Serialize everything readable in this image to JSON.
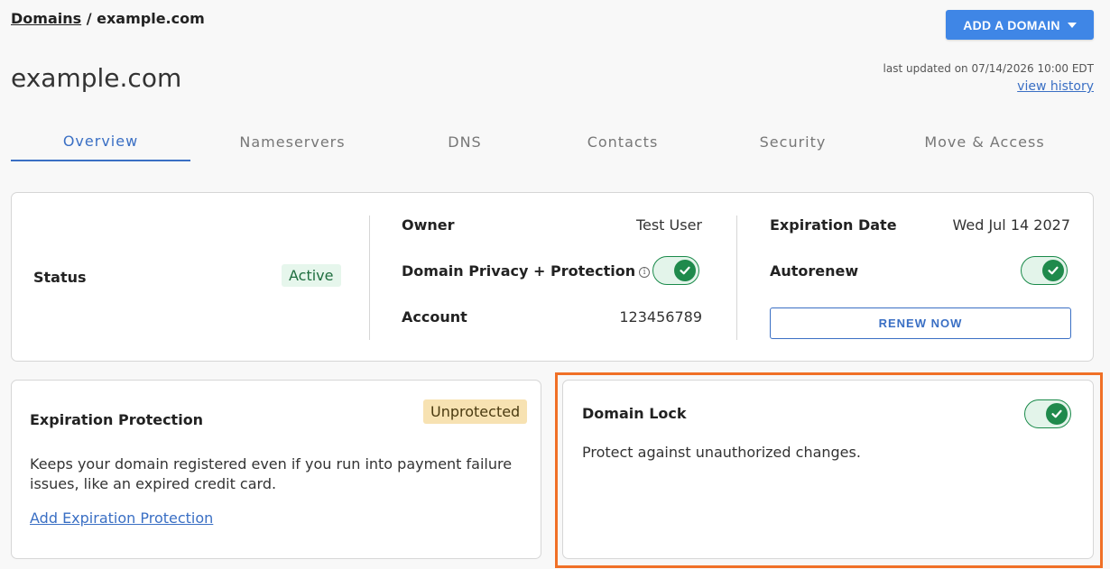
{
  "breadcrumb": {
    "parent": "Domains",
    "separator": " / ",
    "current": "example.com"
  },
  "header": {
    "add_domain_label": "ADD A DOMAIN",
    "title": "example.com",
    "last_updated": "last updated on 07/14/2026 10:00 EDT",
    "view_history": "view history"
  },
  "tabs": [
    {
      "label": "Overview",
      "active": true
    },
    {
      "label": "Nameservers",
      "active": false
    },
    {
      "label": "DNS",
      "active": false
    },
    {
      "label": "Contacts",
      "active": false
    },
    {
      "label": "Security",
      "active": false
    },
    {
      "label": "Move & Access",
      "active": false
    }
  ],
  "status_card": {
    "status_label": "Status",
    "status_value": "Active",
    "owner_label": "Owner",
    "owner_value": "Test User",
    "privacy_label": "Domain Privacy + Protection",
    "privacy_enabled": true,
    "account_label": "Account",
    "account_value": "123456789",
    "expiration_label": "Expiration Date",
    "expiration_value": "Wed Jul 14 2027",
    "autorenew_label": "Autorenew",
    "autorenew_enabled": true,
    "renew_label": "RENEW NOW"
  },
  "expiration_card": {
    "title": "Expiration Protection",
    "badge": "Unprotected",
    "description_line1": "Keeps your domain registered even if you run into payment failure",
    "description_line2": "issues, like an expired credit card.",
    "link": "Add Expiration Protection"
  },
  "lock_card": {
    "title": "Domain Lock",
    "description": "Protect against unauthorized changes.",
    "enabled": true
  },
  "colors": {
    "accent": "#3f86e6",
    "link": "#3a6fc4",
    "success": "#1f8a4c",
    "warning_bg": "#f7e2b2",
    "highlight": "#f07026"
  }
}
